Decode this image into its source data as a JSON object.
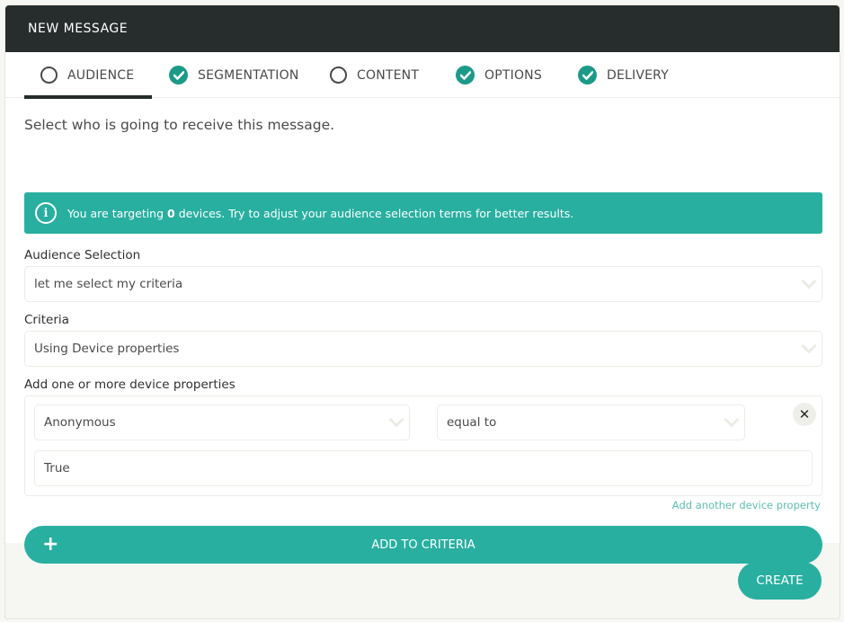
{
  "header": {
    "title": "NEW MESSAGE"
  },
  "tabs": [
    {
      "label": "AUDIENCE",
      "status": "incomplete",
      "active": true
    },
    {
      "label": "SEGMENTATION",
      "status": "complete",
      "active": false
    },
    {
      "label": "CONTENT",
      "status": "incomplete",
      "active": false
    },
    {
      "label": "OPTIONS",
      "status": "complete",
      "active": false
    },
    {
      "label": "DELIVERY",
      "status": "complete",
      "active": false
    }
  ],
  "intro": "Select who is going to receive this message.",
  "alert": {
    "icon": "info-icon",
    "prefix": "You are targeting ",
    "count": "0",
    "suffix": " devices. Try to adjust your audience selection terms for better results."
  },
  "audience_selection": {
    "label": "Audience Selection",
    "value": "let me select my criteria"
  },
  "criteria": {
    "label": "Criteria",
    "value": "Using Device properties"
  },
  "device_properties": {
    "label": "Add one or more device properties",
    "property": "Anonymous",
    "operator": "equal to",
    "value": "True",
    "add_another_label": "Add another device property"
  },
  "add_to_criteria_label": "ADD TO CRITERIA",
  "footer": {
    "create_label": "CREATE"
  },
  "colors": {
    "accent": "#28afa0",
    "check": "#1c9a88",
    "header_bg": "#262d2c"
  }
}
